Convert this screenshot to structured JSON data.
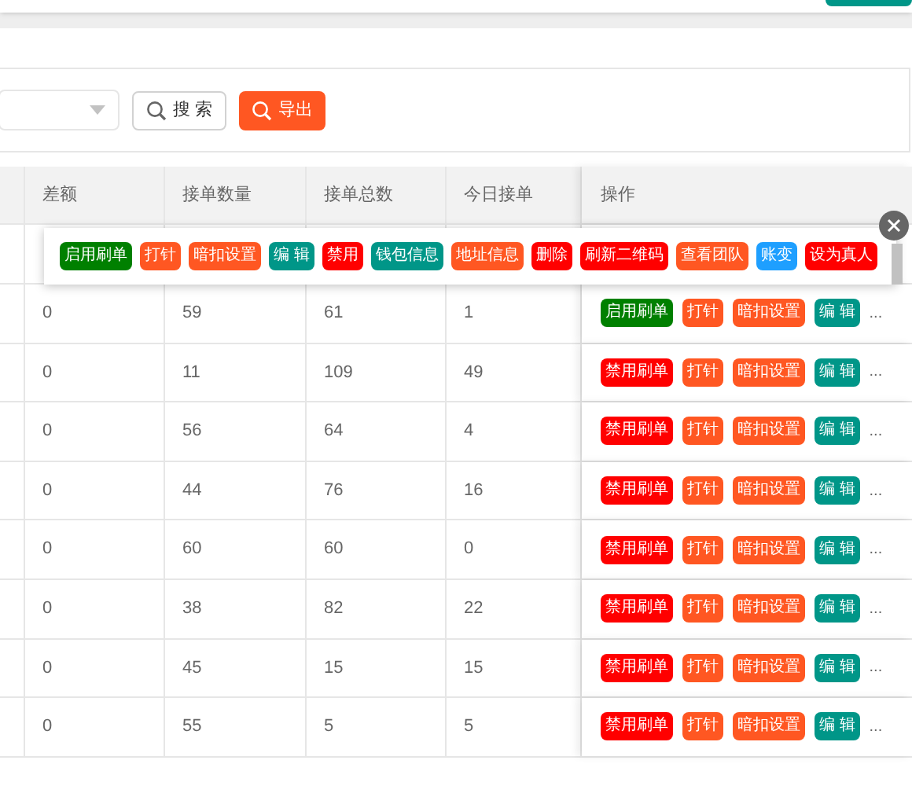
{
  "search_panel": {
    "search_button": "搜 索",
    "export_button": "导出"
  },
  "table": {
    "columns": [
      "差额",
      "接单数量",
      "接单总数",
      "今日接单",
      "操作"
    ],
    "rows": [
      {
        "cells": [
          "",
          "",
          "",
          ""
        ],
        "actions": []
      },
      {
        "cells": [
          "0",
          "59",
          "61",
          "1"
        ],
        "actions": [
          {
            "label": "启用刷单",
            "color": "#008000"
          },
          {
            "label": "打针",
            "color": "#ff5722"
          },
          {
            "label": "暗扣设置",
            "color": "#ff5722"
          },
          {
            "label": "编 辑",
            "color": "#009688"
          }
        ],
        "more": "..."
      },
      {
        "cells": [
          "0",
          "11",
          "109",
          "49"
        ],
        "actions": [
          {
            "label": "禁用刷单",
            "color": "#ff0000"
          },
          {
            "label": "打针",
            "color": "#ff5722"
          },
          {
            "label": "暗扣设置",
            "color": "#ff5722"
          },
          {
            "label": "编 辑",
            "color": "#009688"
          }
        ],
        "more": "..."
      },
      {
        "cells": [
          "0",
          "56",
          "64",
          "4"
        ],
        "actions": [
          {
            "label": "禁用刷单",
            "color": "#ff0000"
          },
          {
            "label": "打针",
            "color": "#ff5722"
          },
          {
            "label": "暗扣设置",
            "color": "#ff5722"
          },
          {
            "label": "编 辑",
            "color": "#009688"
          }
        ],
        "more": "..."
      },
      {
        "cells": [
          "0",
          "44",
          "76",
          "16"
        ],
        "actions": [
          {
            "label": "禁用刷单",
            "color": "#ff0000"
          },
          {
            "label": "打针",
            "color": "#ff5722"
          },
          {
            "label": "暗扣设置",
            "color": "#ff5722"
          },
          {
            "label": "编 辑",
            "color": "#009688"
          }
        ],
        "more": "..."
      },
      {
        "cells": [
          "0",
          "60",
          "60",
          "0"
        ],
        "actions": [
          {
            "label": "禁用刷单",
            "color": "#ff0000"
          },
          {
            "label": "打针",
            "color": "#ff5722"
          },
          {
            "label": "暗扣设置",
            "color": "#ff5722"
          },
          {
            "label": "编 辑",
            "color": "#009688"
          }
        ],
        "more": "..."
      },
      {
        "cells": [
          "0",
          "38",
          "82",
          "22"
        ],
        "actions": [
          {
            "label": "禁用刷单",
            "color": "#ff0000"
          },
          {
            "label": "打针",
            "color": "#ff5722"
          },
          {
            "label": "暗扣设置",
            "color": "#ff5722"
          },
          {
            "label": "编 辑",
            "color": "#009688"
          }
        ],
        "more": "..."
      },
      {
        "cells": [
          "0",
          "45",
          "15",
          "15"
        ],
        "actions": [
          {
            "label": "禁用刷单",
            "color": "#ff0000"
          },
          {
            "label": "打针",
            "color": "#ff5722"
          },
          {
            "label": "暗扣设置",
            "color": "#ff5722"
          },
          {
            "label": "编 辑",
            "color": "#009688"
          }
        ],
        "more": "..."
      },
      {
        "cells": [
          "0",
          "55",
          "5",
          "5"
        ],
        "actions": [
          {
            "label": "禁用刷单",
            "color": "#ff0000"
          },
          {
            "label": "打针",
            "color": "#ff5722"
          },
          {
            "label": "暗扣设置",
            "color": "#ff5722"
          },
          {
            "label": "编 辑",
            "color": "#009688"
          }
        ],
        "more": "..."
      }
    ]
  },
  "action_popup": {
    "buttons": [
      {
        "label": "启用刷单",
        "color": "#008000"
      },
      {
        "label": "打针",
        "color": "#ff5722"
      },
      {
        "label": "暗扣设置",
        "color": "#ff5722"
      },
      {
        "label": "编 辑",
        "color": "#009688"
      },
      {
        "label": "禁用",
        "color": "#ff0000"
      },
      {
        "label": "钱包信息",
        "color": "#009688"
      },
      {
        "label": "地址信息",
        "color": "#ff5722"
      },
      {
        "label": "删除",
        "color": "#ff0000"
      },
      {
        "label": "刷新二维码",
        "color": "#ff0000"
      },
      {
        "label": "查看团队",
        "color": "#ff5722"
      },
      {
        "label": "账变",
        "color": "#1e9fff"
      },
      {
        "label": "设为真人",
        "color": "#ff0000"
      }
    ]
  }
}
